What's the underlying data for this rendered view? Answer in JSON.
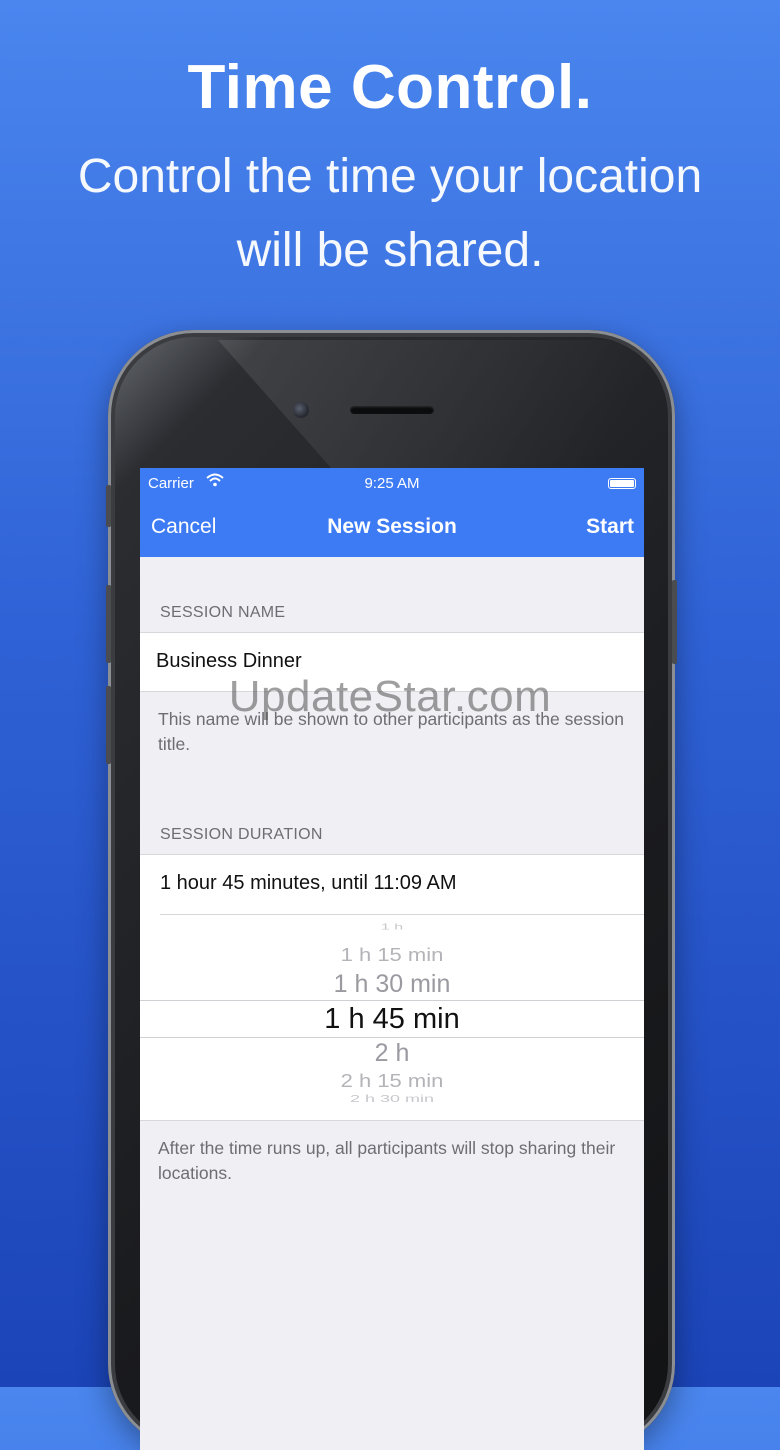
{
  "headline": "Time Control.",
  "subline": "Control the time your location will be shared.",
  "status_bar": {
    "carrier": "Carrier",
    "time": "9:25 AM"
  },
  "nav": {
    "cancel": "Cancel",
    "title": "New Session",
    "start": "Start"
  },
  "session_name": {
    "header": "SESSION NAME",
    "value": "Business Dinner",
    "footer": "This name will be shown to other participants as the session title."
  },
  "session_duration": {
    "header": "SESSION DURATION",
    "summary": "1 hour 45 minutes, until 11:09 AM",
    "picker_options": [
      "1 h",
      "1 h 15 min",
      "1 h 30 min",
      "1 h 45 min",
      "2 h",
      "2 h 15 min",
      "2 h 30 min"
    ],
    "selected_option": "1 h 45 min",
    "footer": "After the time runs up, all participants will stop sharing their locations."
  },
  "watermark": "UpdateStar.com",
  "colors": {
    "background_top": "#4a86ee",
    "background_bottom": "#1b44b8",
    "nav_bar": "#3d7bf5",
    "screen_bg": "#efeff4"
  }
}
